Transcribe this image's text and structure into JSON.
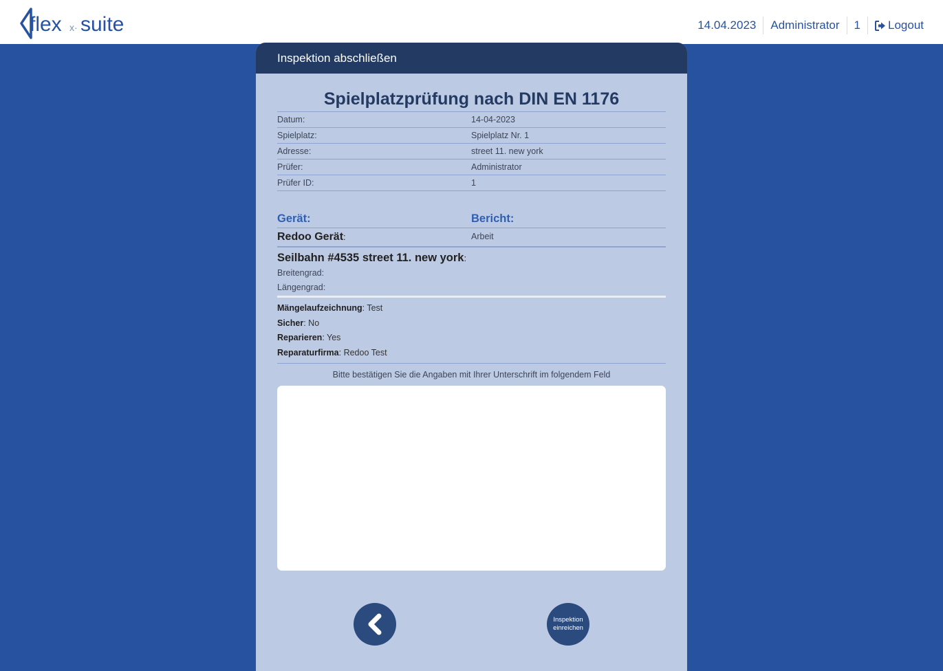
{
  "header": {
    "logo_text": "flex-suite",
    "date": "14.04.2023",
    "user": "Administrator",
    "user_id": "1",
    "logout_label": "Logout",
    "logout_icon": "sign-out-icon"
  },
  "panel": {
    "header_title": "Inspektion abschließen",
    "title": "Spielplatzprüfung nach DIN EN 1176",
    "info_rows": [
      {
        "label": "Datum:",
        "value": "14-04-2023"
      },
      {
        "label": "Spielplatz:",
        "value": "Spielplatz Nr. 1"
      },
      {
        "label": "Adresse:",
        "value": "street 11. new york"
      },
      {
        "label": "Prüfer:",
        "value": "Administrator"
      },
      {
        "label": "Prüfer ID:",
        "value": "1"
      }
    ],
    "device_heading": "Gerät:",
    "report_heading": "Bericht:",
    "device_name": "Redoo Gerät",
    "colon": ":",
    "report_value": "Arbeit",
    "equipment_title": "Seilbahn #4535 street 11. new york",
    "latitude_label": "Breitengrad:",
    "longitude_label": "Längengrad:",
    "details": [
      {
        "label": "Mängelaufzeichnung",
        "value": ": Test"
      },
      {
        "label": "Sicher",
        "value": ": No"
      },
      {
        "label": "Reparieren",
        "value": ": Yes"
      },
      {
        "label": "Reparaturfirma",
        "value": ": Redoo Test"
      }
    ],
    "confirm_text": "Bitte bestätigen Sie die Angaben mit Ihrer Unterschrift im folgendem Feld",
    "back_icon": "chevron-left-icon",
    "submit_label_line1": "Inspektion",
    "submit_label_line2": "einreichen"
  },
  "colors": {
    "background": "#2652a0",
    "panel": "#bdcae3",
    "panel_header": "#233a62",
    "accent": "#2f5fb3",
    "button": "#2b4a7e"
  }
}
